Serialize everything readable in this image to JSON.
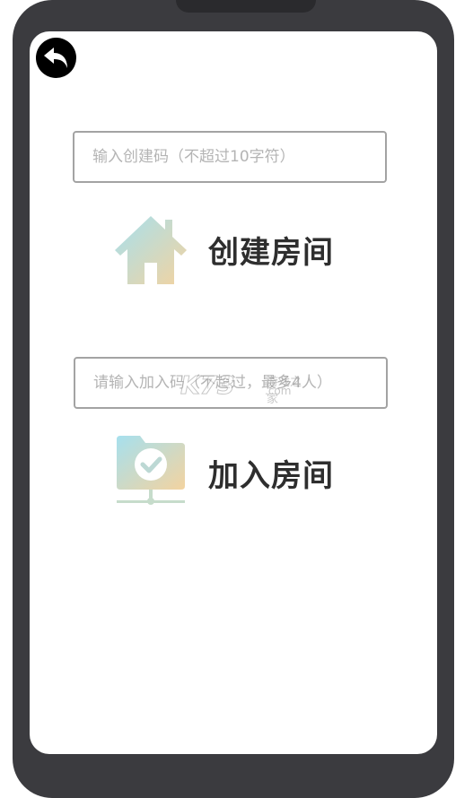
{
  "create": {
    "input_placeholder": "输入创建码（不超过10字符）",
    "button_label": "创建房间",
    "icon": "house-icon"
  },
  "join": {
    "input_placeholder": "请输入加入码（不超过，最多4人）",
    "button_label": "加入房间",
    "icon": "folder-check-icon"
  },
  "nav": {
    "back_icon": "back-arrow-icon"
  },
  "watermark": {
    "main": "K73",
    "top": "游戏之家",
    "bottom": ".com"
  },
  "colors": {
    "frame": "#3b3b3f",
    "screen": "#ffffff",
    "label": "#2e2e2e",
    "icon_gradient_start": "#a6e0ee",
    "icon_gradient_end": "#f3d3a0"
  }
}
